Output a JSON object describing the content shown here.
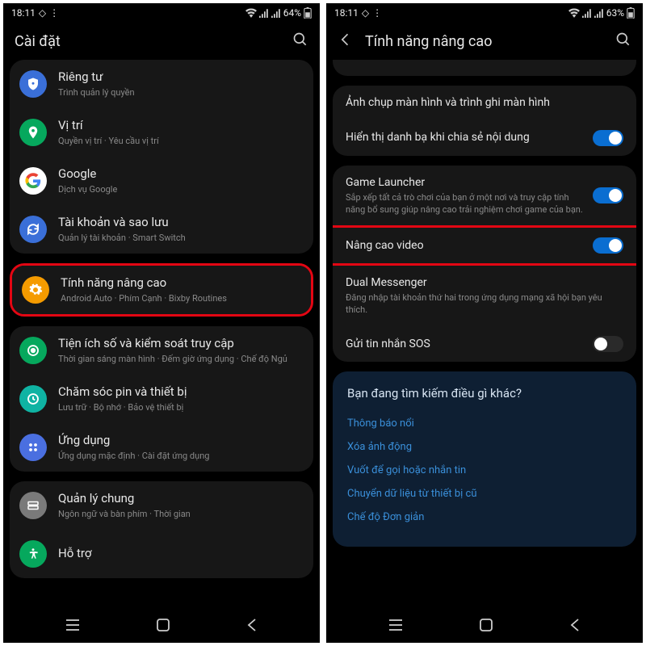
{
  "left": {
    "status": {
      "time": "18:11",
      "battery": "64%"
    },
    "header": {
      "title": "Cài đặt"
    },
    "groups": [
      {
        "items": [
          {
            "icon": "shield",
            "color": "#3a6fd8",
            "title": "Riêng tư",
            "sub": "Trình quản lý quyền"
          },
          {
            "icon": "pin",
            "color": "#06a85d",
            "title": "Vị trí",
            "sub": "Quyền vị trí  ·  Yêu cầu vị trí"
          },
          {
            "icon": "google",
            "color": "#ffffff",
            "title": "Google",
            "sub": "Dịch vụ Google"
          },
          {
            "icon": "sync",
            "color": "#3a6fd8",
            "title": "Tài khoản và sao lưu",
            "sub": "Quản lý tài khoản  ·  Smart Switch"
          }
        ]
      },
      {
        "highlight": true,
        "items": [
          {
            "icon": "gear",
            "color": "#f59b00",
            "title": "Tính năng nâng cao",
            "sub": "Android Auto  ·  Phím Cạnh  ·  Bixby Routines"
          }
        ]
      },
      {
        "items": [
          {
            "icon": "wellbeing",
            "color": "#06a85d",
            "title": "Tiện ích số và kiểm soát truy cập",
            "sub": "Thời gian sáng màn hình  ·  Đếm giờ ứng dụng  ·  Chế độ Ngủ"
          },
          {
            "icon": "battery",
            "color": "#0fb3a3",
            "title": "Chăm sóc pin và thiết bị",
            "sub": "Lưu trữ  ·  Bộ nhớ  ·  Bảo vệ thiết bị"
          },
          {
            "icon": "apps",
            "color": "#4a6fe0",
            "title": "Ứng dụng",
            "sub": "Ứng dụng mặc định  ·  Cài đặt ứng dụng"
          }
        ]
      },
      {
        "items": [
          {
            "icon": "general",
            "color": "#7a7a7a",
            "title": "Quản lý chung",
            "sub": "Ngôn ngữ và bàn phím  ·  Thời gian"
          },
          {
            "icon": "access",
            "color": "#06a85d",
            "title": "Hỗ trợ",
            "sub": ""
          }
        ]
      }
    ]
  },
  "right": {
    "status": {
      "time": "18:11",
      "battery": "63%"
    },
    "header": {
      "title": "Tính năng nâng cao"
    },
    "sections": [
      {
        "rows": [
          {
            "title": "Ảnh chụp màn hình và trình ghi màn hình",
            "sub": "",
            "toggle": null
          },
          {
            "title": "Hiển thị danh bạ khi chia sẻ nội dung",
            "sub": "",
            "toggle": true
          }
        ]
      },
      {
        "rows": [
          {
            "title": "Game Launcher",
            "sub": "Sắp xếp tất cả trò chơi của bạn ở một nơi và truy cập tính năng bổ sung giúp nâng cao trải nghiệm chơi game của bạn.",
            "toggle": true
          },
          {
            "title": "Nâng cao video",
            "sub": "",
            "toggle": true,
            "highlight": true
          },
          {
            "title": "Dual Messenger",
            "sub": "Đăng nhập tài khoản thứ hai trong ứng dụng mạng xã hội bạn yêu thích.",
            "toggle": null
          },
          {
            "title": "Gửi tin nhắn SOS",
            "sub": "",
            "toggle": false
          }
        ]
      }
    ],
    "suggest": {
      "header": "Bạn đang tìm kiếm điều gì khác?",
      "links": [
        "Thông báo nổi",
        "Xóa ảnh động",
        "Vuốt để gọi hoặc nhắn tin",
        "Chuyển dữ liệu từ thiết bị cũ",
        "Chế độ Đơn giản"
      ]
    }
  }
}
